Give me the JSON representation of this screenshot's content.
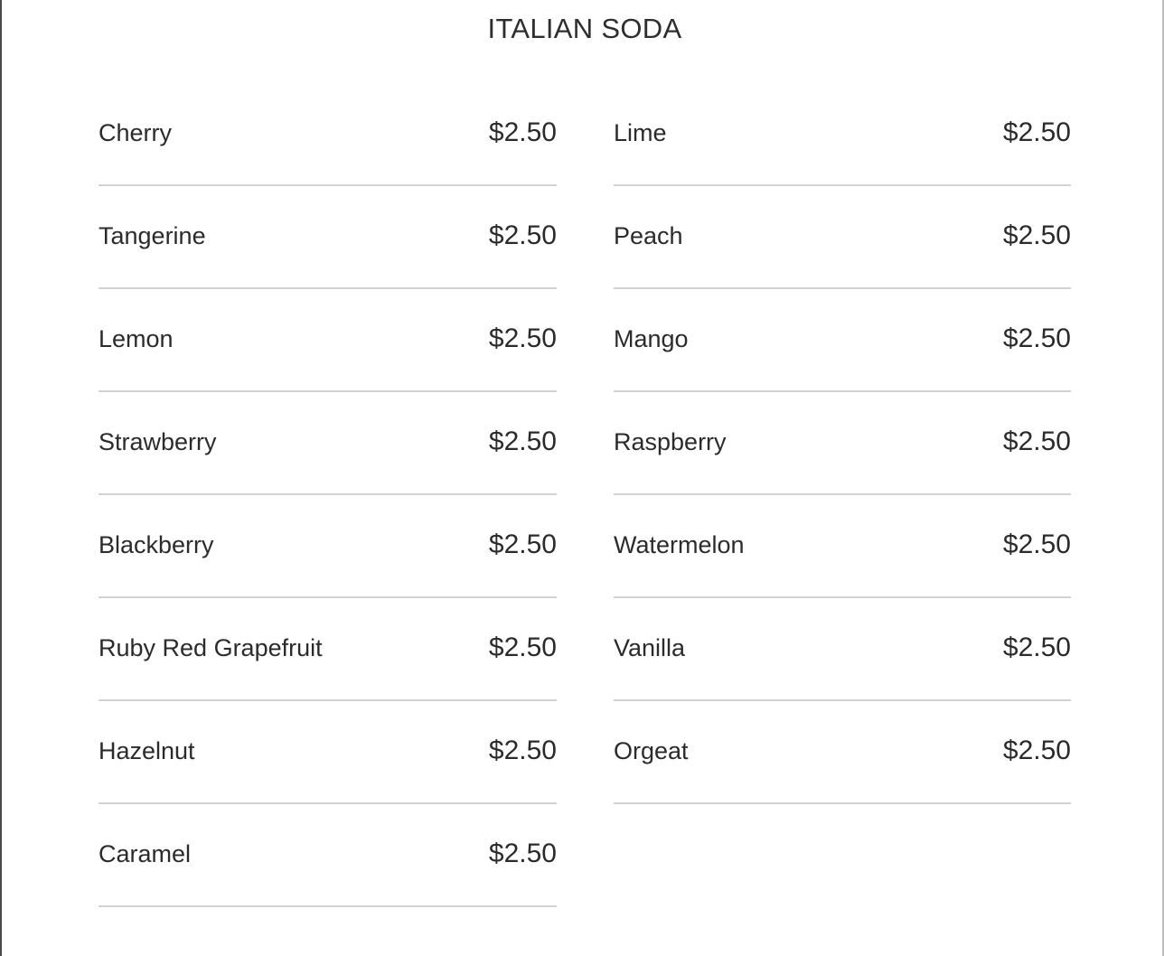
{
  "menu": {
    "title": "ITALIAN SODA",
    "left_items": [
      {
        "name": "Cherry",
        "price": "$2.50"
      },
      {
        "name": "Tangerine",
        "price": "$2.50"
      },
      {
        "name": "Lemon",
        "price": "$2.50"
      },
      {
        "name": "Strawberry",
        "price": "$2.50"
      },
      {
        "name": "Blackberry",
        "price": "$2.50"
      },
      {
        "name": "Ruby Red Grapefruit",
        "price": "$2.50"
      },
      {
        "name": "Hazelnut",
        "price": "$2.50"
      },
      {
        "name": "Caramel",
        "price": "$2.50"
      }
    ],
    "right_items": [
      {
        "name": "Lime",
        "price": "$2.50"
      },
      {
        "name": "Peach",
        "price": "$2.50"
      },
      {
        "name": "Mango",
        "price": "$2.50"
      },
      {
        "name": "Raspberry",
        "price": "$2.50"
      },
      {
        "name": "Watermelon",
        "price": "$2.50"
      },
      {
        "name": "Vanilla",
        "price": "$2.50"
      },
      {
        "name": "Orgeat",
        "price": "$2.50"
      }
    ]
  }
}
